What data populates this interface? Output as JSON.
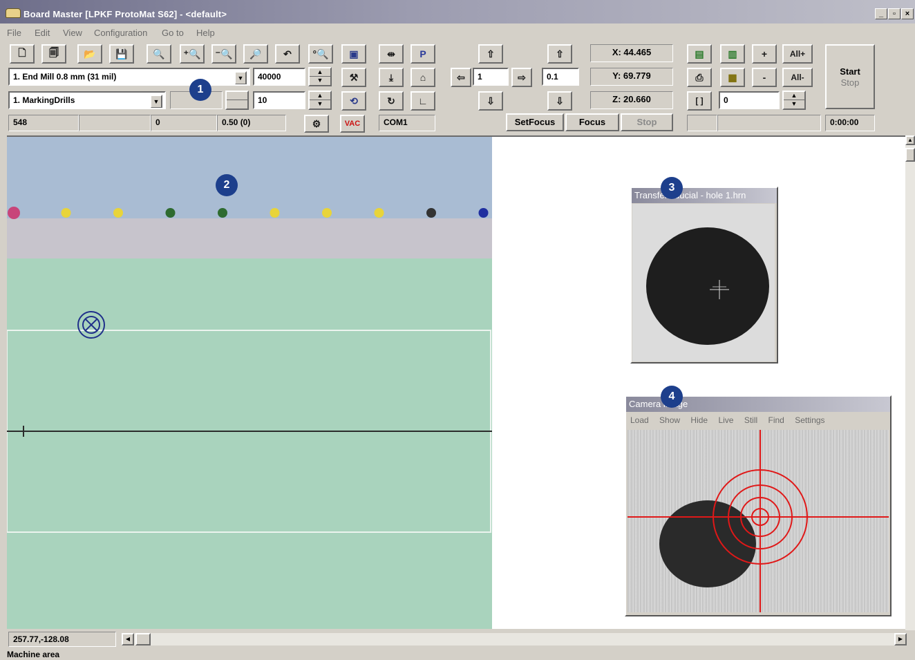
{
  "window": {
    "title": "Board Master [LPKF ProtoMat S62] - <default>",
    "ctl_min": "_",
    "ctl_max": "▫",
    "ctl_close": "×"
  },
  "menu": [
    "File",
    "Edit",
    "View",
    "Configuration",
    "Go to",
    "Help"
  ],
  "tools": {
    "tool_select": "1.  End Mill 0.8 mm (31 mil)",
    "phase_select": "1.  MarkingDrills",
    "speed": "40000",
    "depth": "10",
    "step": "1",
    "step2": "0.1",
    "counter": "0",
    "com_port": "COM1",
    "timer": "0:00:00"
  },
  "status_row": {
    "cell1": "548",
    "cell2": "",
    "cell3": "0",
    "cell4": "0.50 (0)"
  },
  "coords": {
    "x": "X: 44.465",
    "y": "Y: 69.779",
    "z": "Z: 20.660"
  },
  "buttons": {
    "setfocus": "SetFocus",
    "focus": "Focus",
    "stop": "Stop",
    "start": "Start",
    "start_stop": "Stop",
    "plus": "+",
    "all_plus": "All+",
    "minus": "-",
    "all_minus": "All-",
    "brackets": "[ ]",
    "vac": "VAC"
  },
  "badges": [
    "1",
    "2",
    "3",
    "4"
  ],
  "fiducial_window": {
    "title": "Transfer fiducial - hole 1.hrn"
  },
  "camera_window": {
    "title": "Camera image",
    "menu": [
      "Load",
      "Show",
      "Hide",
      "Live",
      "Still",
      "Find",
      "Settings"
    ]
  },
  "layer_dots": [
    {
      "color": "#c8457a"
    },
    {
      "color": "#e8d43a"
    },
    {
      "color": "#e8d43a"
    },
    {
      "color": "#2e6b30"
    },
    {
      "color": "#2e6b30"
    },
    {
      "color": "#e8d43a"
    },
    {
      "color": "#e8d43a"
    },
    {
      "color": "#e8d43a"
    },
    {
      "color": "#333333"
    },
    {
      "color": "#1f2fa0"
    }
  ],
  "colors": {
    "layer_band": "#a9bcd3",
    "machine_band": "#c7c4cc",
    "board": "#a9d3bd",
    "crosshair": "#e01818"
  },
  "statusbar": {
    "position": "257.77,-128.08",
    "area": "Machine area"
  }
}
